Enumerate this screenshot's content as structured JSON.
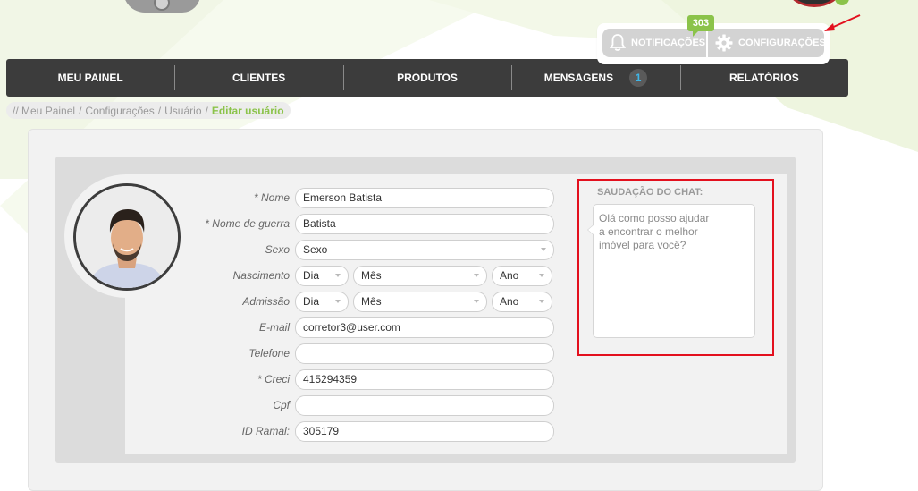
{
  "top_actions": {
    "notifications_label": "NOTIFICAÇÕES",
    "notifications_count": "303",
    "settings_label": "CONFIGURAÇÕES"
  },
  "nav": {
    "items": [
      {
        "label": "MEU PAINEL"
      },
      {
        "label": "CLIENTES"
      },
      {
        "label": "PRODUTOS"
      },
      {
        "label": "MENSAGENS",
        "count": "1"
      },
      {
        "label": "RELATÓRIOS"
      }
    ]
  },
  "breadcrumb": {
    "prefix": "//",
    "items": [
      "Meu Painel",
      "Configurações",
      "Usuário"
    ],
    "active": "Editar usuário"
  },
  "form": {
    "nome": {
      "label": "* Nome",
      "value": "Emerson Batista"
    },
    "nome_guerra": {
      "label": "* Nome de guerra",
      "value": "Batista"
    },
    "sexo": {
      "label": "Sexo",
      "value": "Sexo"
    },
    "nascimento": {
      "label": "Nascimento",
      "dia": "Dia",
      "mes": "Mês",
      "ano": "Ano"
    },
    "admissao": {
      "label": "Admissão",
      "dia": "Dia",
      "mes": "Mês",
      "ano": "Ano"
    },
    "email": {
      "label": "E-mail",
      "value": "corretor3@user.com"
    },
    "telefone": {
      "label": "Telefone",
      "value": ""
    },
    "creci": {
      "label": "* Creci",
      "value": "415294359"
    },
    "cpf": {
      "label": "Cpf",
      "value": ""
    },
    "id_ramal": {
      "label": "ID Ramal:",
      "value": "305179"
    }
  },
  "chat": {
    "title": "SAUDAÇÃO DO CHAT:",
    "lines": [
      "Olá como posso ajudar",
      "a encontrar o melhor",
      "imóvel para você?"
    ]
  },
  "colors": {
    "accent_green": "#8bc34a",
    "nav_bg": "#3c3c3c",
    "highlight_red": "#e3101e",
    "message_count_blue": "#3fb6e8"
  }
}
